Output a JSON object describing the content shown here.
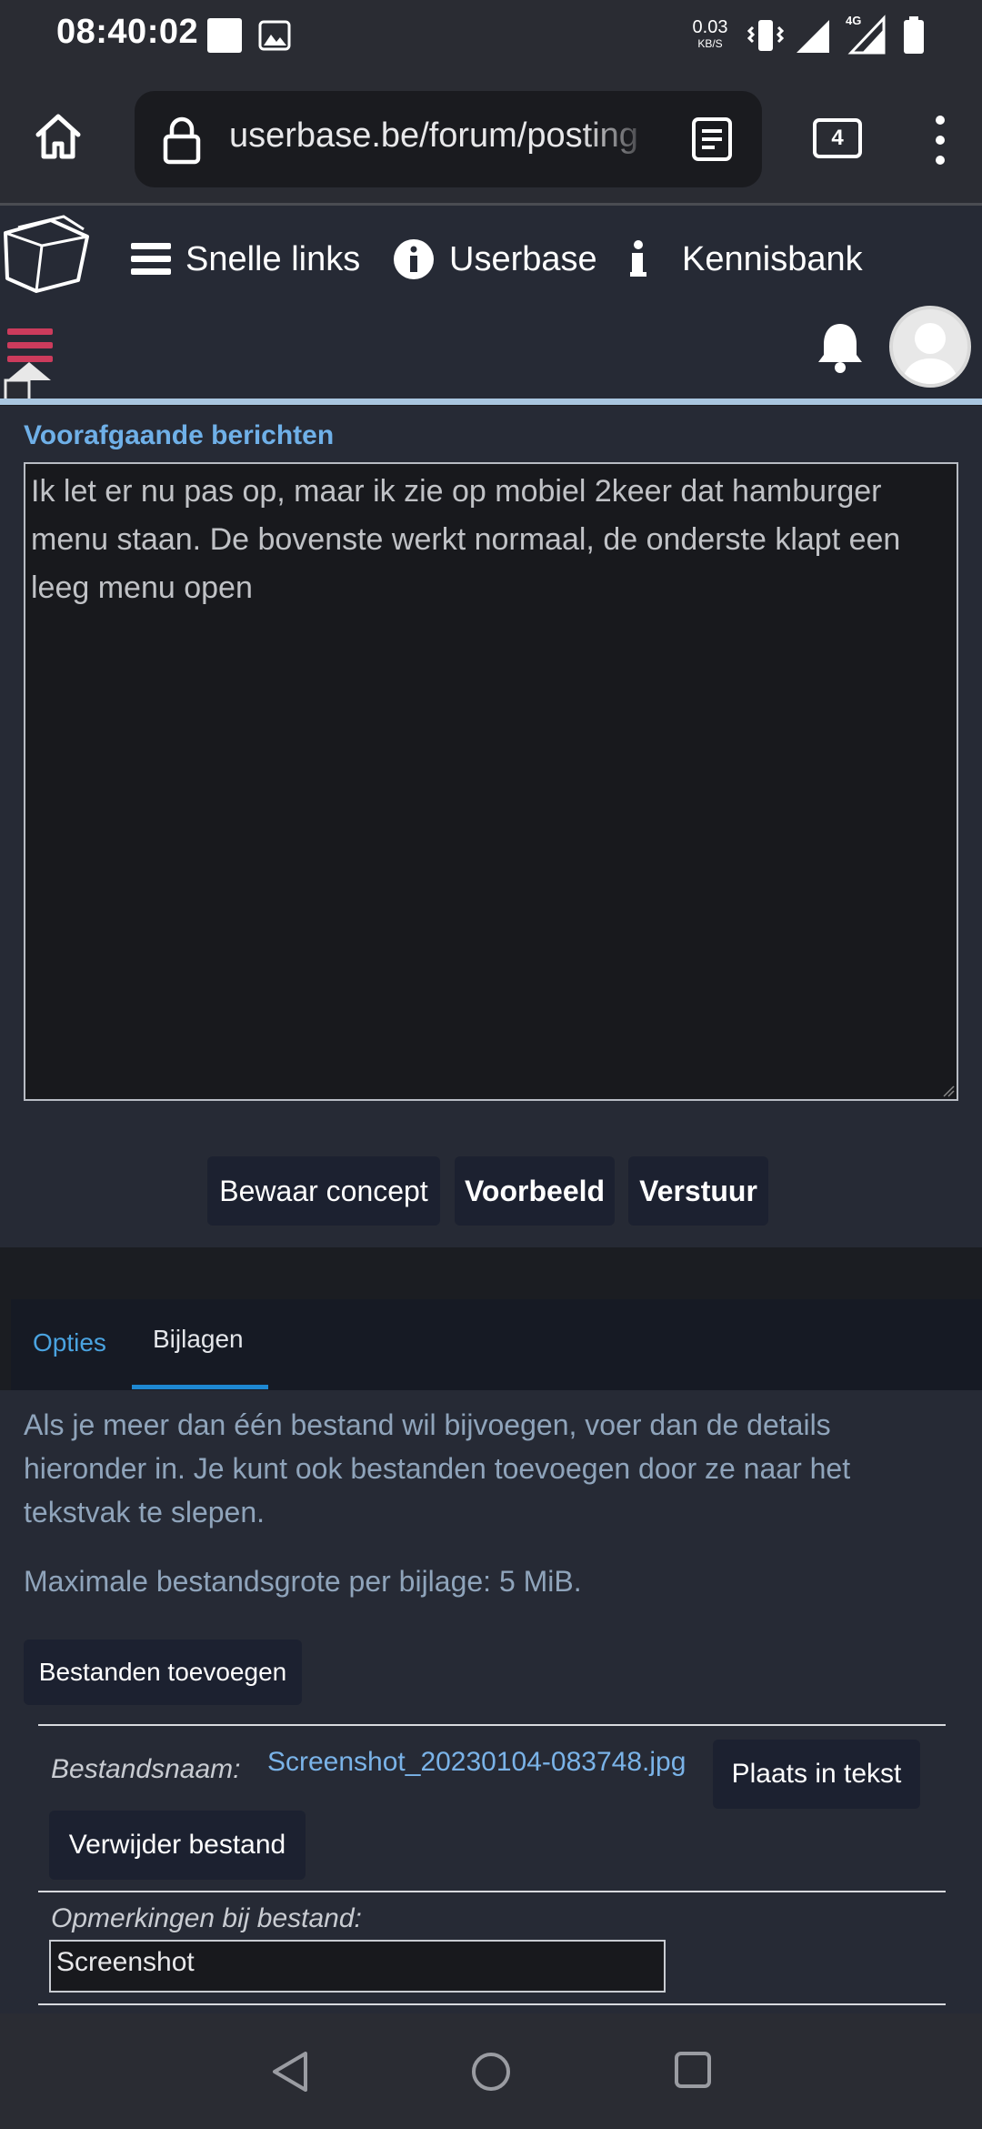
{
  "status_bar": {
    "time": "08:40:02",
    "net_speed": "0.03",
    "net_unit": "KB/S",
    "network_type": "4G"
  },
  "browser": {
    "url": "userbase.be/forum/posting",
    "tab_count": "4"
  },
  "site_nav": {
    "items": [
      {
        "label": "Snelle links",
        "icon": "hamburger-icon"
      },
      {
        "label": "Userbase",
        "icon": "info-circle-icon"
      },
      {
        "label": "Kennisbank",
        "icon": "info-icon"
      }
    ]
  },
  "editor": {
    "previous_messages_title": "Voorafgaande berichten",
    "message_text": "Ik let er nu pas op, maar ik zie op mobiel 2keer dat hamburger menu staan. De bovenste werkt normaal, de onderste klapt een leeg menu open"
  },
  "actions": {
    "save_draft": "Bewaar concept",
    "preview": "Voorbeeld",
    "submit": "Verstuur"
  },
  "tabs": [
    {
      "label": "Opties",
      "active": false
    },
    {
      "label": "Bijlagen",
      "active": true
    }
  ],
  "attachments": {
    "info": "Als je meer dan één bestand wil bijvoegen, voer dan de details hieronder in. Je kunt ook bestanden toevoegen door ze naar het tekstvak te slepen.",
    "max_size": "Maximale bestandsgrote per bijlage: 5 MiB.",
    "add_files": "Bestanden toevoegen",
    "filename_label": "Bestandsnaam:",
    "filename": "Screenshot_20230104-083748.jpg",
    "place_in_text": "Plaats in tekst",
    "delete_file": "Verwijder bestand",
    "comment_label": "Opmerkingen bij bestand:",
    "comment_value": "Screenshot"
  },
  "colors": {
    "accent_blue": "#4aa3e0",
    "link_blue": "#7ab3e8",
    "hamburger_red": "#cc3b5c",
    "background": "#262a35"
  }
}
